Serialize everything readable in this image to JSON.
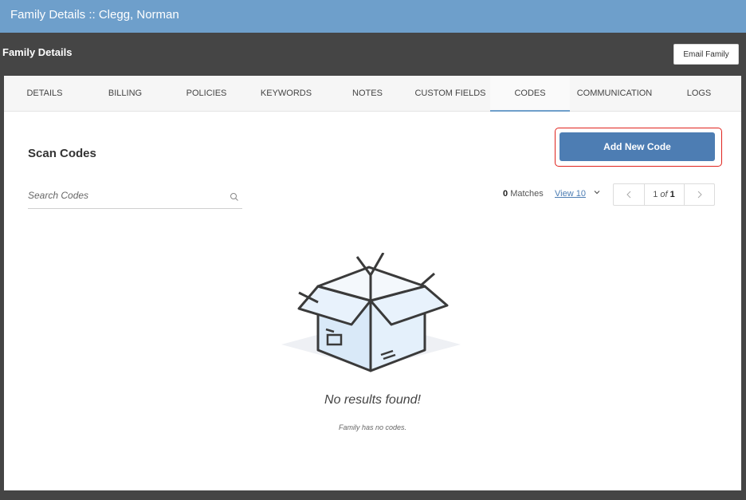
{
  "window": {
    "title": "Family Details :: Clegg, Norman"
  },
  "header": {
    "title": "Family Details",
    "email_button": "Email Family"
  },
  "tabs": [
    {
      "label": "DETAILS",
      "active": false
    },
    {
      "label": "BILLING",
      "active": false
    },
    {
      "label": "POLICIES",
      "active": false
    },
    {
      "label": "KEYWORDS",
      "active": false
    },
    {
      "label": "NOTES",
      "active": false
    },
    {
      "label": "CUSTOM FIELDS",
      "active": false
    },
    {
      "label": "CODES",
      "active": true
    },
    {
      "label": "COMMUNICATION",
      "active": false
    },
    {
      "label": "LOGS",
      "active": false
    }
  ],
  "section": {
    "title": "Scan Codes",
    "add_button": "Add New Code"
  },
  "search": {
    "placeholder": "Search Codes",
    "value": "",
    "icon": "search-icon"
  },
  "results": {
    "matches_count": "0",
    "matches_label": "Matches",
    "view_label": "View 10",
    "page_current": "1",
    "page_of": "of",
    "page_total": "1"
  },
  "empty_state": {
    "title": "No results found!",
    "subtitle": "Family has no codes.",
    "icon": "open-box-icon"
  },
  "colors": {
    "titlebar": "#6e9fcb",
    "header": "#454545",
    "accent": "#4d7db3",
    "highlight_outline": "#e0231d"
  }
}
